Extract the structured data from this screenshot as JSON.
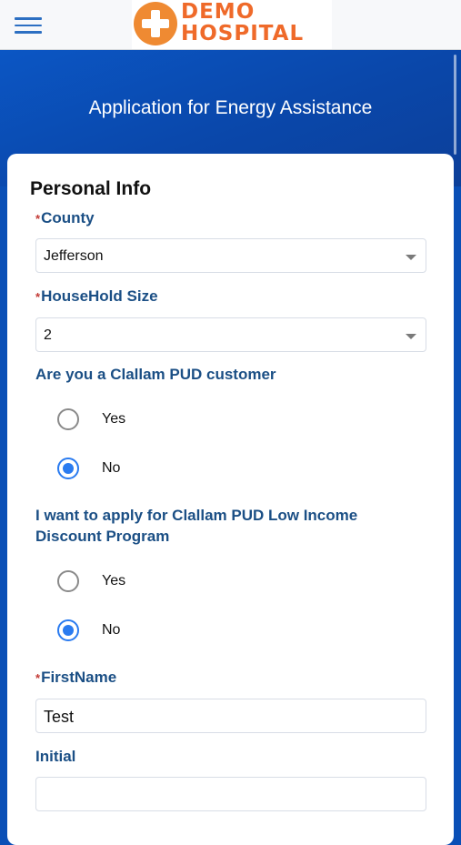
{
  "header": {
    "logo": {
      "line1": "DEMO",
      "line2": "HOSPITAL",
      "icon": "plus-cross-icon"
    },
    "menu_icon": "hamburger-menu-icon"
  },
  "app_title": "Application for Energy Assistance",
  "form": {
    "section_title": "Personal Info",
    "required_marker": "*",
    "county": {
      "label": "County",
      "value": "Jefferson"
    },
    "household_size": {
      "label": "HouseHold Size",
      "value": "2"
    },
    "pud_customer": {
      "question": "Are you a Clallam PUD customer",
      "options": [
        {
          "label": "Yes",
          "selected": false
        },
        {
          "label": "No",
          "selected": true
        }
      ]
    },
    "low_income": {
      "question_line1": "I want to apply for Clallam PUD Low Income",
      "question_line2": "Discount Program",
      "options": [
        {
          "label": "Yes",
          "selected": false
        },
        {
          "label": "No",
          "selected": true
        }
      ]
    },
    "first_name": {
      "label": "FirstName",
      "value": "Test"
    },
    "initial": {
      "label": "Initial",
      "value": ""
    }
  },
  "colors": {
    "brand_orange": "#ef6a2a",
    "hero_blue": "#0a4fb6",
    "label_blue": "#1b4f85",
    "radio_blue": "#2a7bf0",
    "required_red": "#c23934"
  }
}
